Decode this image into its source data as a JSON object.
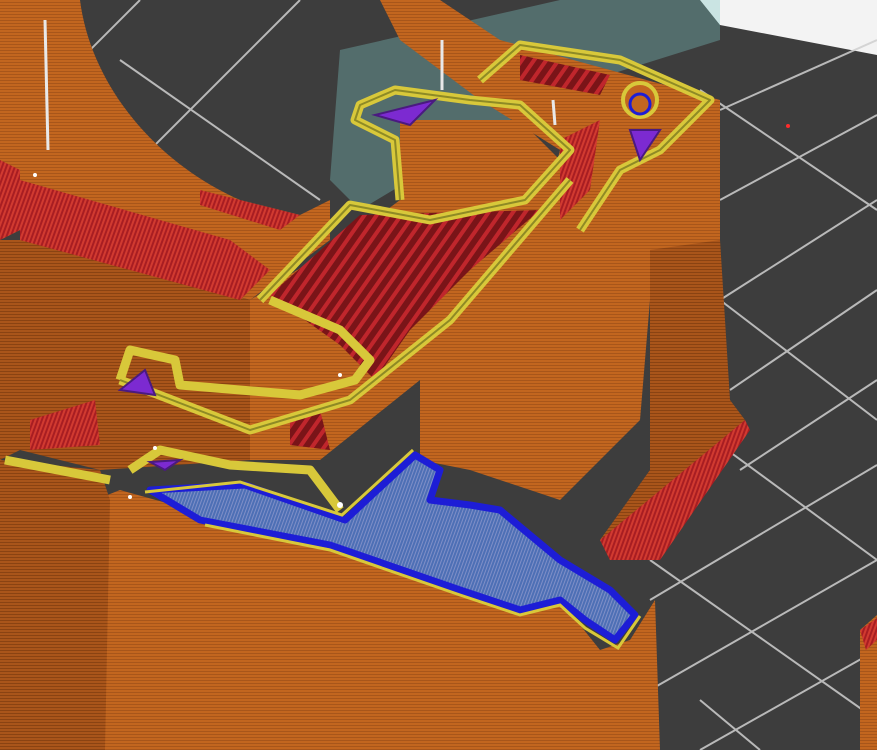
{
  "app": {
    "view": "3d-preview",
    "description_kind": "sliced-gcode-toolpath-preview"
  },
  "colors": {
    "bed": "#3d3d3d",
    "bed_grid": "#cfcfcf",
    "outer_wall": "#c2661f",
    "outer_wall_dark": "#9a4f16",
    "inner_wall": "#d8c83a",
    "inner_wall_edge": "#8e8a25",
    "sparse_infill": "#b11f26",
    "solid_infill": "#7c2ad1",
    "top_surface": "#1d1dd6",
    "top_surface_fill": "#4f73b9",
    "support_ghost": "#7fc9c6",
    "background_light": "#f3f3f3"
  },
  "icons": {
    "seam": "seam-marker-icon",
    "screw": "screw-hole-icon"
  }
}
